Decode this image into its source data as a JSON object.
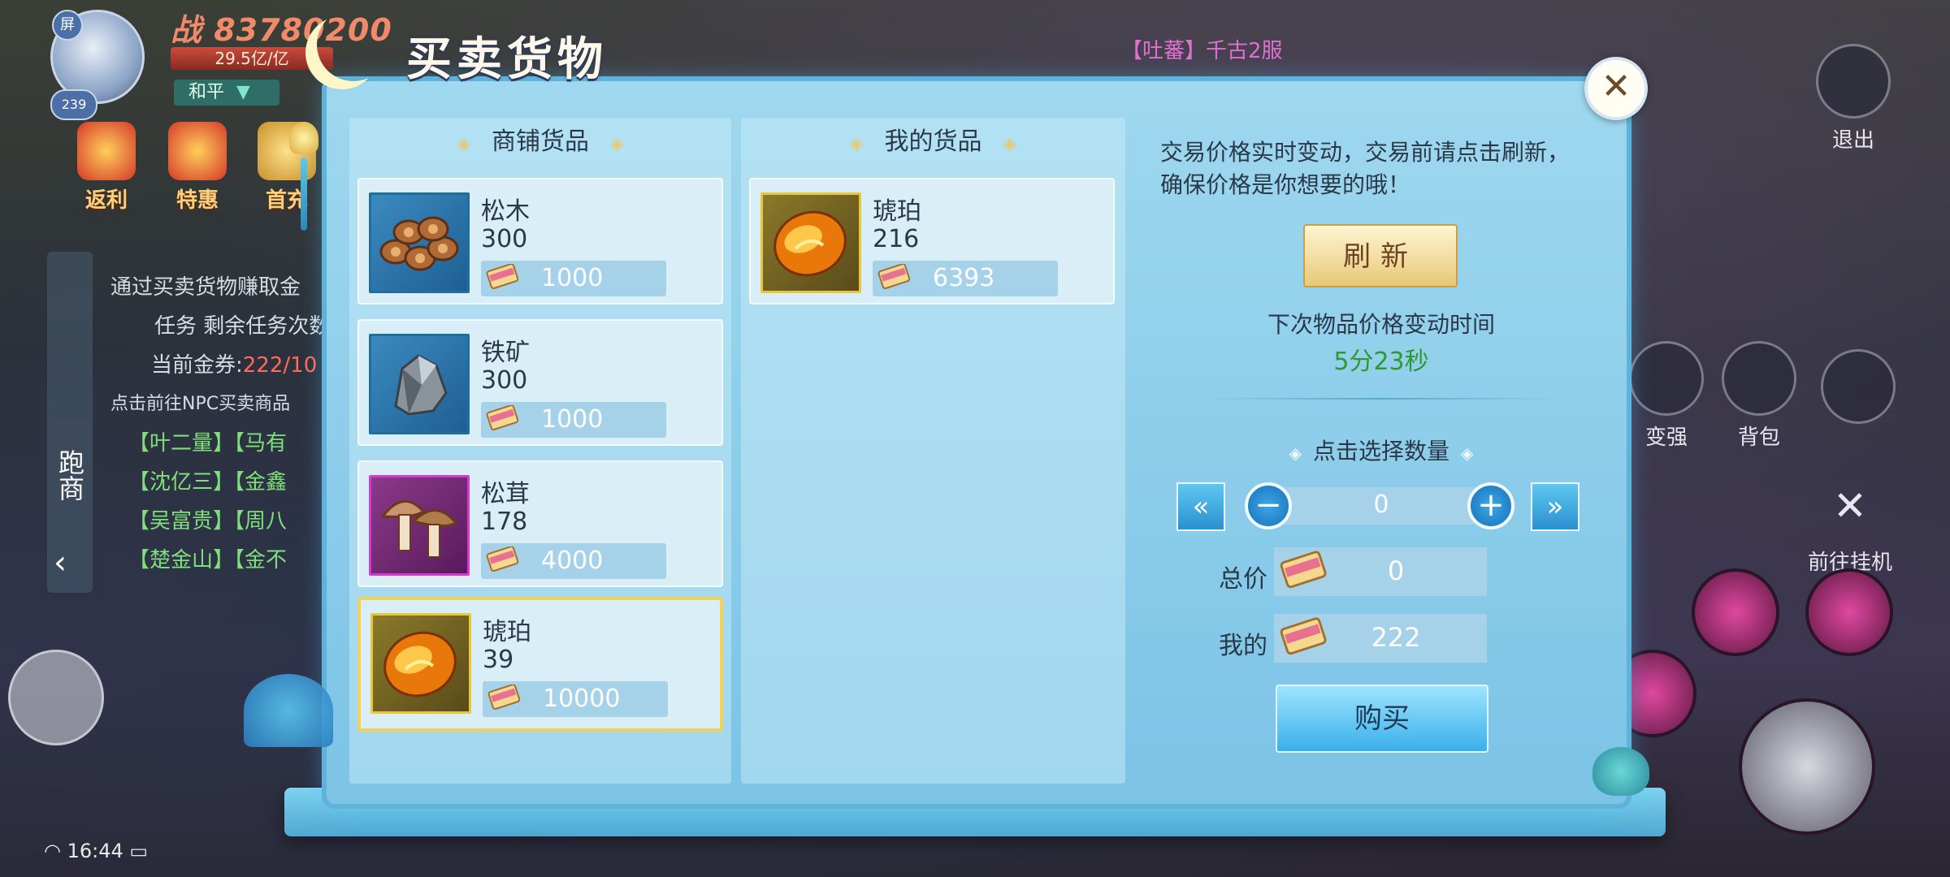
{
  "hud": {
    "avatar_corner": "屏",
    "level": "239",
    "power": "战 83780200",
    "hp": "29.5亿/亿",
    "mode": "和平",
    "icons": [
      {
        "label": "返利",
        "icon": "gift-icon"
      },
      {
        "label": "特惠",
        "icon": "sale-icon"
      },
      {
        "label": "首充",
        "icon": "gold-ingot-icon"
      }
    ],
    "side_tab": "跑商",
    "quest": {
      "line1": "通过买卖货物赚取金",
      "line2": "任务 剩余任务次数",
      "coupon_label": "当前金券:",
      "coupon_value": "222/10",
      "hint": "点击前往NPC买卖商品",
      "npcs": [
        "【叶二量】【马有",
        "【沈亿三】【金鑫",
        "【吴富贵】【周八",
        "【楚金山】【金不"
      ]
    },
    "chat": "【吐蕃】千古2服",
    "right_buttons": [
      {
        "label": "退出",
        "icon": "exit-icon"
      },
      {
        "label": "变强",
        "icon": "strength-icon"
      },
      {
        "label": "背包",
        "icon": "bag-icon"
      },
      {
        "label": "前往挂机",
        "icon": "swords-icon"
      }
    ],
    "status_time": "16:44"
  },
  "dialog": {
    "title": "买卖货物",
    "close_icon": "close-icon",
    "shop_header": "商铺货品",
    "mine_header": "我的货品",
    "shop_items": [
      {
        "name": "松木",
        "qty": "300",
        "price": "1000",
        "icon": "pine-wood-icon"
      },
      {
        "name": "铁矿",
        "qty": "300",
        "price": "1000",
        "icon": "iron-ore-icon"
      },
      {
        "name": "松茸",
        "qty": "178",
        "price": "4000",
        "icon": "matsutake-icon"
      },
      {
        "name": "琥珀",
        "qty": "39",
        "price": "10000",
        "icon": "amber-icon",
        "selected": true
      }
    ],
    "my_items": [
      {
        "name": "琥珀",
        "qty": "216",
        "price": "6393",
        "icon": "amber-icon"
      }
    ],
    "info": {
      "notice": "交易价格实时变动，交易前请点击刷新，确保价格是你想要的哦！",
      "refresh": "刷新",
      "next_change_label": "下次物品价格变动时间",
      "timer": "5分23秒",
      "choose_qty": "点击选择数量",
      "qty": "0",
      "total_label": "总价",
      "total_value": "0",
      "mine_label": "我的",
      "mine_value": "222",
      "buy": "购买"
    }
  },
  "colors": {
    "accent": "#7cc3e6",
    "selected_border": "#f2d25a",
    "timer": "#2e9a2e"
  }
}
